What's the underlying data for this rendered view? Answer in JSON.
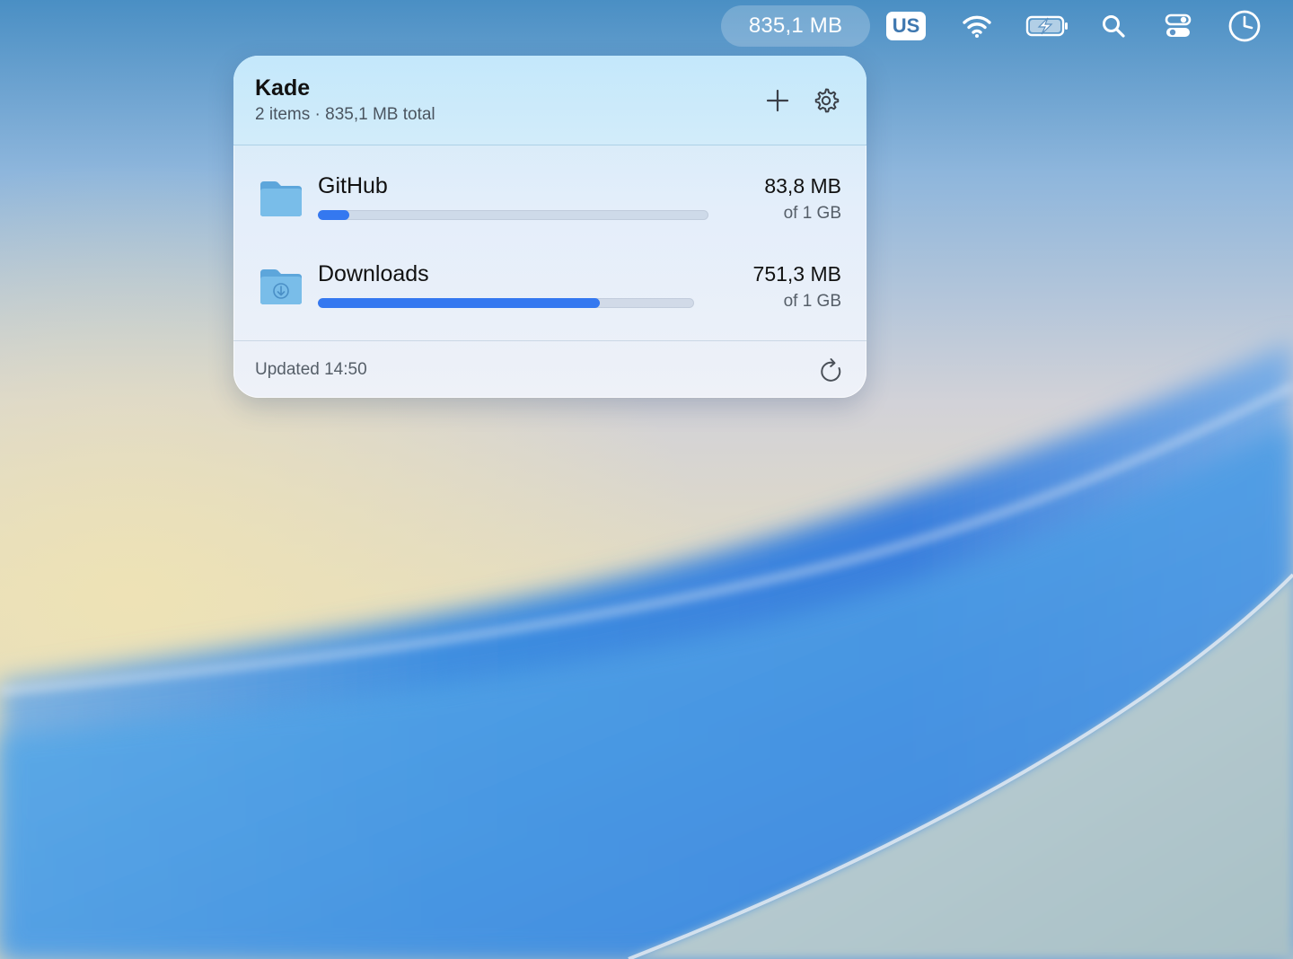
{
  "menubar": {
    "storage_label": "835,1 MB",
    "input_source": "US",
    "icons": [
      "wifi-icon",
      "battery-charging-icon",
      "search-icon",
      "control-center-icon",
      "clock-icon"
    ]
  },
  "popover": {
    "title": "Kade",
    "subtitle": "2 items · 835,1 MB total",
    "items": [
      {
        "name": "GitHub",
        "size": "83,8 MB",
        "capacity": "of 1 GB",
        "usage_fraction": 0.08,
        "icon": "folder-icon"
      },
      {
        "name": "Downloads",
        "size": "751,3 MB",
        "capacity": "of 1 GB",
        "usage_fraction": 0.75,
        "icon": "downloads-folder-icon"
      }
    ],
    "footer": "Updated 14:50"
  },
  "colors": {
    "accent": "#3478f0",
    "menubar_text": "#ffffff"
  }
}
